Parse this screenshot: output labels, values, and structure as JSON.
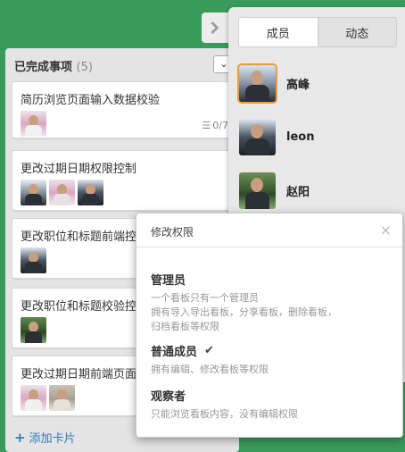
{
  "list": {
    "title": "已完成事项",
    "count": "(5)",
    "toggle_icon": "chevron-down-icon",
    "cards": [
      {
        "title": "简历浏览页面输入数据校验",
        "checklist": "0/7"
      },
      {
        "title": "更改过期日期权限控制"
      },
      {
        "title": "更改职位和标题前端控制"
      },
      {
        "title": "更改职位和标题校验控制"
      },
      {
        "title": "更改过期日期前端页面"
      }
    ],
    "add_card": "添加卡片"
  },
  "panel": {
    "tabs": [
      "成员",
      "动态"
    ],
    "members": [
      {
        "name": "高峰"
      },
      {
        "name": "leon"
      },
      {
        "name": "赵阳"
      }
    ]
  },
  "popup": {
    "title": "修改权限",
    "close": "×",
    "roles": [
      {
        "name": "管理员",
        "desc1": "一个看板只有一个管理员",
        "desc2": "拥有导入导出看板，分享看板，删除看板，",
        "desc3": "归档看板等权限"
      },
      {
        "name": "普通成员",
        "desc1": "拥有编辑、修改看板等权限"
      },
      {
        "name": "观察者",
        "desc1": "只能浏览看板内容，没有编辑权限"
      }
    ],
    "check": "✔"
  },
  "colors": {
    "background": "#3a9a5c",
    "link": "#2f7bbf",
    "selected_border": "#e89c3b"
  }
}
